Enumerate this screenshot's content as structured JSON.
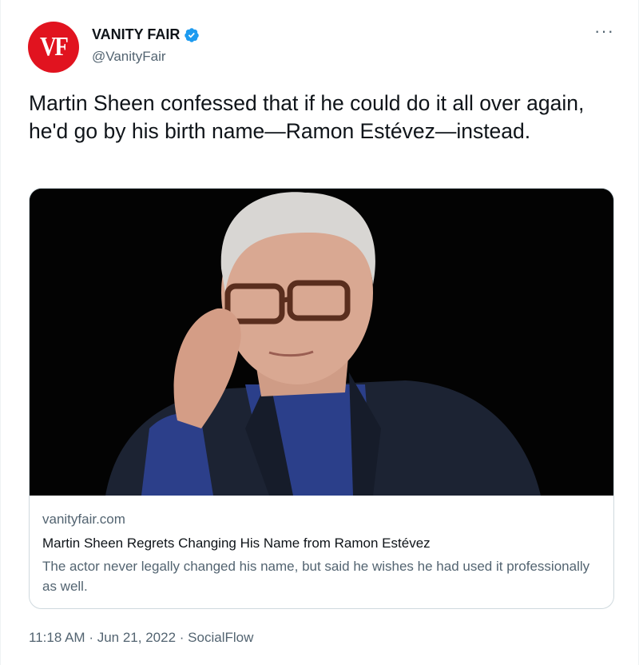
{
  "author": {
    "avatar_text": "VF",
    "display_name": "VANITY FAIR",
    "handle": "@VanityFair",
    "verified": true
  },
  "more_icon": "···",
  "tweet_text": "Martin Sheen confessed that if he could do it all over again, he'd go by his birth name—Ramon Estévez—instead.",
  "card": {
    "domain": "vanityfair.com",
    "title": "Martin Sheen Regrets Changing His Name from Ramon Estévez",
    "description": "The actor never legally changed his name, but said he wishes he had used it professionally as well.",
    "image_alt": "portrait-photo"
  },
  "meta": {
    "time": "11:18 AM",
    "separator": "·",
    "date": "Jun 21, 2022",
    "source": "SocialFlow"
  },
  "colors": {
    "accent": "#1d9bf0",
    "brand_red": "#e1131f",
    "secondary_text": "#536471"
  }
}
